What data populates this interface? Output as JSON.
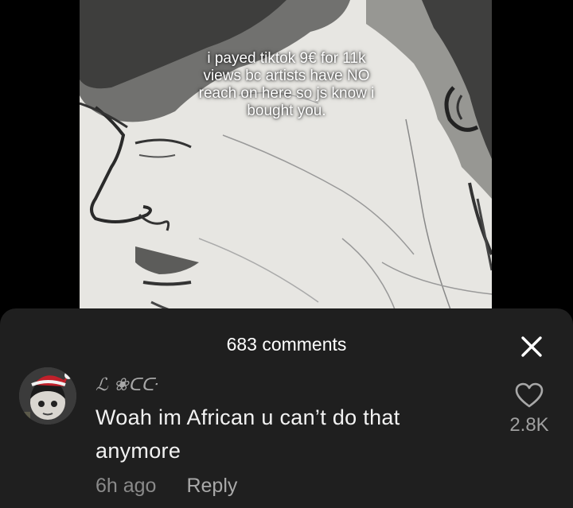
{
  "video": {
    "overlay_lines": [
      "i payed tiktok 9€ for 11k",
      "views bc artists have NO",
      "reach on here so js know i",
      "bought you."
    ]
  },
  "comments_sheet": {
    "title": "683 comments",
    "close_icon": "close-icon"
  },
  "comment": {
    "username": "ℒ ❀ᑕᑢ",
    "text_lines": [
      "Woah im African u can’t do that",
      "anymore"
    ],
    "time": "6h ago",
    "reply_label": "Reply",
    "likes": "2.8K",
    "like_icon": "heart-outline-icon"
  },
  "colors": {
    "sheet_bg": "#1f1f1f",
    "text_primary": "#f2f2f2",
    "text_secondary": "#8a8a8a"
  }
}
